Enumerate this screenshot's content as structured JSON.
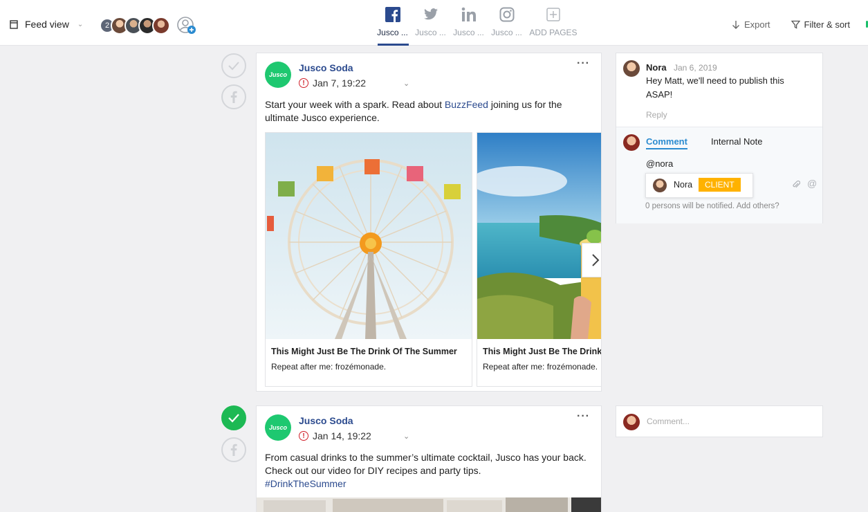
{
  "toolbar": {
    "view_label": "Feed view",
    "avatar_count": "2",
    "export_label": "Export",
    "filter_label": "Filter & sort"
  },
  "tabs": [
    {
      "label": "Jusco ...",
      "icon": "facebook-icon",
      "active": true
    },
    {
      "label": "Jusco ...",
      "icon": "twitter-icon",
      "active": false
    },
    {
      "label": "Jusco ...",
      "icon": "linkedin-icon",
      "active": false
    },
    {
      "label": "Jusco ...",
      "icon": "instagram-icon",
      "active": false
    },
    {
      "label": "ADD PAGES",
      "icon": "add-square-icon",
      "active": false
    }
  ],
  "colors": {
    "brand_blue": "#2b4a8e",
    "brand_green": "#1ec870",
    "approved_green": "#1db954",
    "warning_red": "#d0202a",
    "client_badge": "#ffb200",
    "comment_tab_blue": "#2b8bd0"
  },
  "posts": [
    {
      "brand_logo_text": "Jusco",
      "brand_name": "Jusco Soda",
      "date": "Jan 7, 19:22",
      "status": "pending",
      "text_before_link": "Start your week with a spark. Read about ",
      "link": "BuzzFeed",
      "text_after_link": " joining us for the ultimate Jusco experience.",
      "cards": [
        {
          "title": "This Might Just Be The Drink Of The Summer",
          "desc": "Repeat after me: frozémonade.",
          "image": "ferris-wheel"
        },
        {
          "title": "This Might Just Be The Drink Of The Summer",
          "desc": "Repeat after me: frozémonade.",
          "image": "beach-drink"
        }
      ]
    },
    {
      "brand_logo_text": "Jusco",
      "brand_name": "Jusco Soda",
      "date": "Jan 14, 19:22",
      "status": "approved",
      "text": "From casual drinks to the summer’s ultimate cocktail, Jusco has your back. Check out our video for DIY recipes and party tips.",
      "hashtag": "#DrinkTheSummer"
    }
  ],
  "comments": {
    "author": "Nora",
    "date": "Jan 6, 2019",
    "text": "Hey Matt, we'll need to publish this ASAP!",
    "reply_label": "Reply",
    "tab_comment": "Comment",
    "tab_internal": "Internal Note",
    "draft": "@nora",
    "mention_name": "Nora",
    "mention_badge": "CLIENT",
    "notify_text": "0 persons will be notified. Add others?",
    "placeholder": "Comment..."
  }
}
